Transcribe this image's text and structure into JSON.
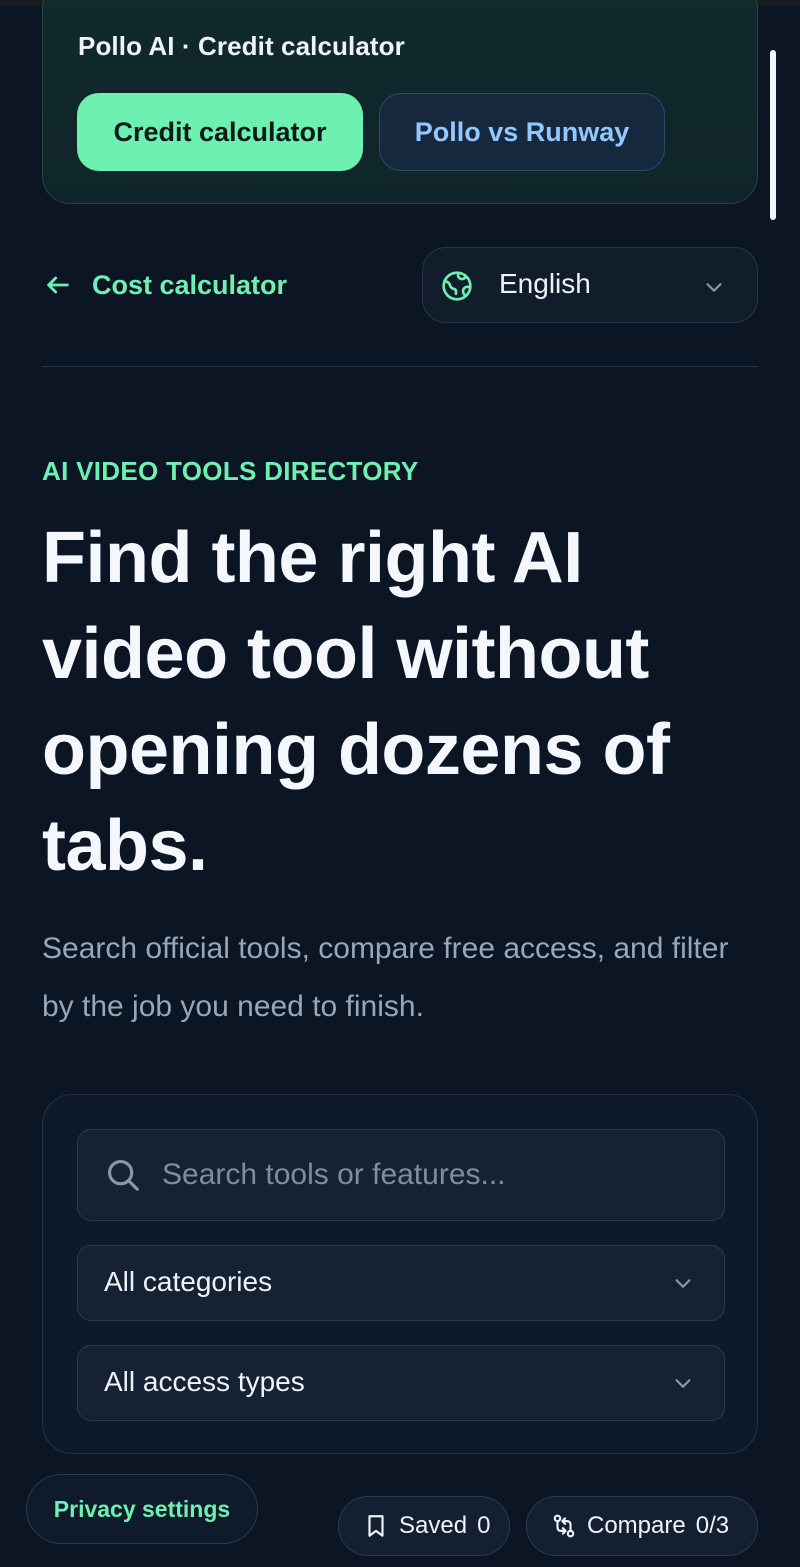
{
  "promo": {
    "title": "Pollo AI · Credit calculator",
    "primary_button": "Credit calculator",
    "secondary_button": "Pollo vs Runway"
  },
  "nav": {
    "back_label": "Cost calculator",
    "language": "English"
  },
  "hero": {
    "eyebrow": "AI VIDEO TOOLS DIRECTORY",
    "title": "Find the right AI video tool without opening dozens of tabs.",
    "subtitle": "Search official tools, compare free access, and filter by the job you need to finish."
  },
  "filters": {
    "search_placeholder": "Search tools or features...",
    "search_value": "",
    "category_selected": "All categories",
    "access_selected": "All access types"
  },
  "bottom_bar": {
    "privacy_label": "Privacy settings",
    "saved_label": "Saved",
    "saved_count": "0",
    "compare_label": "Compare",
    "compare_count": "0/3"
  },
  "colors": {
    "background": "#0b1524",
    "accent": "#6ef0b0",
    "link_blue": "#93c8ff",
    "muted_text": "#97a6b8"
  },
  "icons": {
    "back": "arrow-left-icon",
    "language": "globe-icon",
    "dropdown": "chevron-down-icon",
    "search": "search-icon",
    "saved": "bookmark-icon",
    "compare": "compare-arrows-icon"
  }
}
